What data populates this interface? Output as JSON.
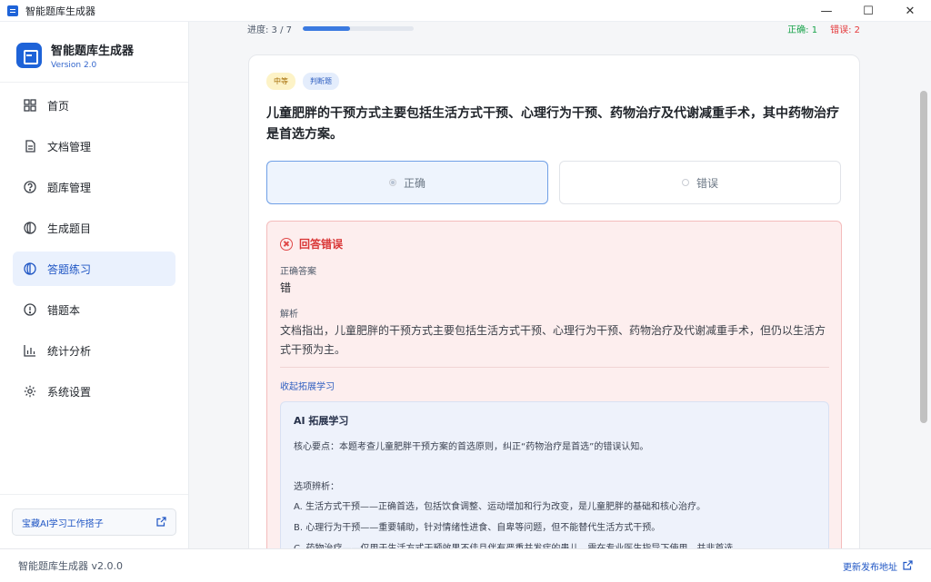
{
  "window": {
    "title": "智能题库生成器",
    "controls": {
      "minimize": "—",
      "maximize": "☐",
      "close": "✕"
    }
  },
  "sidebar": {
    "brand_name": "智能题库生成器",
    "brand_version": "Version 2.0",
    "items": [
      {
        "label": "首页",
        "icon": "grid-icon",
        "active": false
      },
      {
        "label": "文档管理",
        "icon": "document-icon",
        "active": false
      },
      {
        "label": "题库管理",
        "icon": "question-circle-icon",
        "active": false
      },
      {
        "label": "生成题目",
        "icon": "half-circle-icon",
        "active": false
      },
      {
        "label": "答题练习",
        "icon": "half-circle-icon",
        "active": true
      },
      {
        "label": "错题本",
        "icon": "alert-circle-icon",
        "active": false
      },
      {
        "label": "统计分析",
        "icon": "bar-chart-icon",
        "active": false
      },
      {
        "label": "系统设置",
        "icon": "gear-icon",
        "active": false
      }
    ],
    "link_label": "宝藏AI学习工作搭子"
  },
  "header": {
    "progress_label": "进度: 3 / 7",
    "progress_current": 3,
    "progress_total": 7,
    "correct_label": "正确: 1",
    "wrong_label": "错误: 2"
  },
  "question": {
    "difficulty": "中等",
    "type": "判断题",
    "text": "儿童肥胖的干预方式主要包括生活方式干预、心理行为干预、药物治疗及代谢减重手术，其中药物治疗是首选方案。",
    "options": [
      {
        "label": "正确",
        "selected": true
      },
      {
        "label": "错误",
        "selected": false
      }
    ]
  },
  "result": {
    "title": "回答错误",
    "correct_answer_label": "正确答案",
    "correct_answer": "错",
    "explanation_label": "解析",
    "explanation": "文档指出，儿童肥胖的干预方式主要包括生活方式干预、心理行为干预、药物治疗及代谢减重手术，但仍以生活方式干预为主。",
    "toggle_label": "收起拓展学习",
    "ai": {
      "title": "AI 拓展学习",
      "core": "核心要点：本题考查儿童肥胖干预方案的首选原则，纠正“药物治疗是首选”的错误认知。",
      "options_heading": "选项辨析：",
      "line_a": "A. 生活方式干预——正确首选，包括饮食调整、运动增加和行为改变，是儿童肥胖的基础和核心治疗。",
      "line_b": "B. 心理行为干预——重要辅助，针对情绪性进食、自卑等问题，但不能替代生活方式干预。",
      "line_c": "C. 药物治疗——仅用于生活方式干预效果不佳且伴有严重并发症的患儿，需在专业医生指导下使用，并非首选。"
    }
  },
  "statusbar": {
    "app_version": "智能题库生成器 v2.0.0",
    "release_link": "更新发布地址"
  },
  "colors": {
    "accent": "#1e63d8",
    "correct": "#18a34a",
    "wrong": "#e5393b",
    "error_bg": "#fdeeee"
  }
}
